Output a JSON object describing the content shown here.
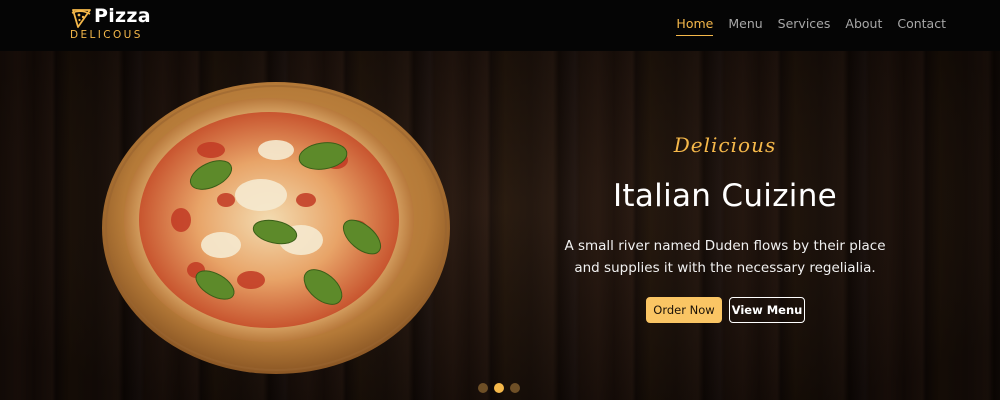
{
  "brand": {
    "name": "Pizza",
    "tagline": "DELICOUS"
  },
  "nav": [
    {
      "label": "Home",
      "active": true
    },
    {
      "label": "Menu",
      "active": false
    },
    {
      "label": "Services",
      "active": false
    },
    {
      "label": "About",
      "active": false
    },
    {
      "label": "Contact",
      "active": false
    }
  ],
  "hero": {
    "subtitle": "Delicious",
    "title": "Italian Cuizine",
    "description_lines": [
      "A small river named Duden flows by their place",
      "and supplies it with the necessary regelialia."
    ],
    "primary_button": "Order Now",
    "secondary_button": "View Menu"
  },
  "carousel": {
    "slides": 3,
    "active_slide": 2
  },
  "colors": {
    "accent": "#f5b84a",
    "button": "#fac564",
    "nav_bg": "#050505"
  },
  "icons": {
    "logo": "pizza-slice-icon"
  }
}
